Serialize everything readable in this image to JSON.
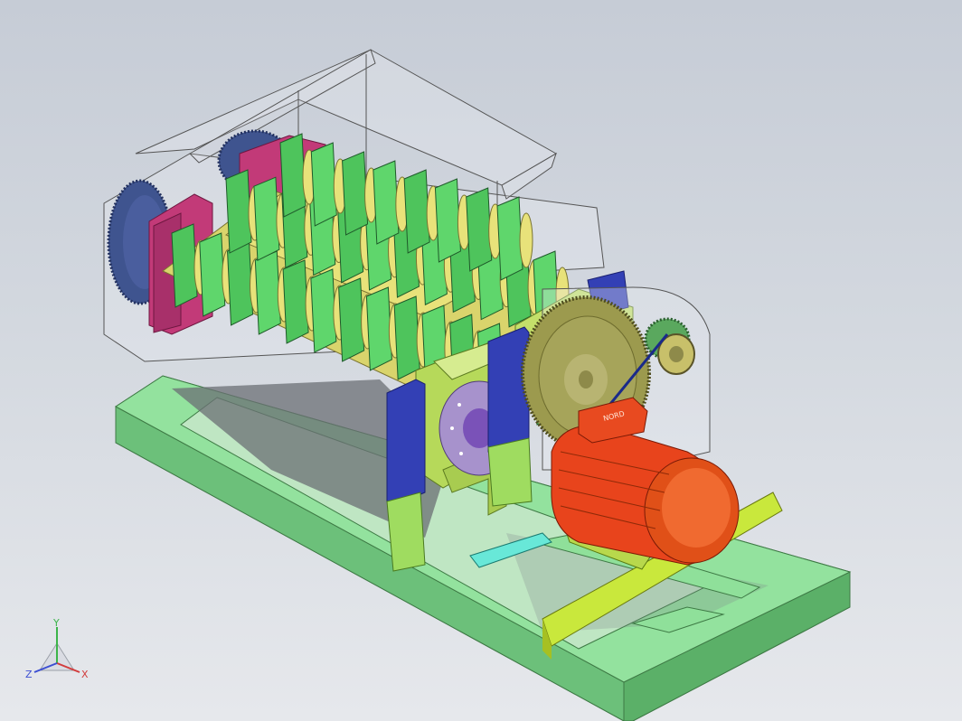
{
  "viewport": {
    "background_top": "#c6ccd6",
    "background_bottom": "#e6e8ec"
  },
  "model": {
    "motor_nameplate": "NORD",
    "colors": {
      "frame": "#8fe09a",
      "frame_edge": "#3e7a45",
      "blades": "#5fd66c",
      "spacers": "#e8e27a",
      "end_gears": "#4a5e9e",
      "bearing_housings": "#c23a78",
      "bearing_blocks": "#b6d95a",
      "side_supports": "#3340b5",
      "flange_plate": "#a792cc",
      "big_gear": "#9c9a4e",
      "pinion": "#5aa85e",
      "motor": "#e8441c",
      "motor_rail": "#c9e83c",
      "hopper": "#f2f2f6"
    }
  },
  "triad": {
    "x_label": "X",
    "y_label": "Y",
    "z_label": "Z",
    "x_color": "#d23c3c",
    "y_color": "#3cb44a",
    "z_color": "#3c4fd2"
  }
}
